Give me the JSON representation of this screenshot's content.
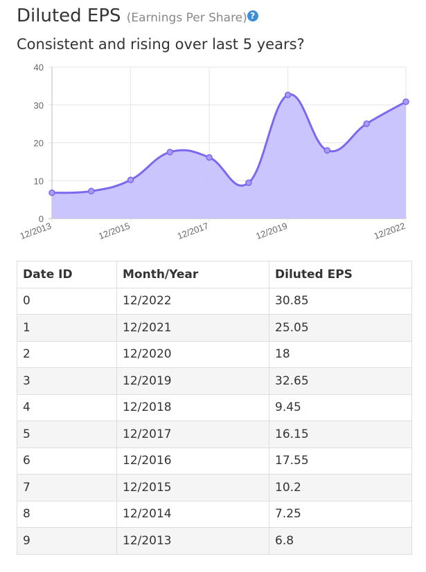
{
  "header": {
    "title": "Diluted EPS",
    "subtitle": "(Earnings Per Share)",
    "help_icon": "?",
    "question": "Consistent and rising over last 5 years?"
  },
  "chart_data": {
    "type": "area",
    "x": [
      "12/2013",
      "12/2014",
      "12/2015",
      "12/2016",
      "12/2017",
      "12/2018",
      "12/2019",
      "12/2020",
      "12/2021",
      "12/2022"
    ],
    "values": [
      6.8,
      7.25,
      10.2,
      17.55,
      16.15,
      9.45,
      32.65,
      18,
      25.05,
      30.85
    ],
    "x_tick_labels": [
      "12/2013",
      "12/2015",
      "12/2017",
      "12/2019",
      "12/2022"
    ],
    "y_ticks": [
      "0",
      "10",
      "20",
      "30",
      "40"
    ],
    "ylim": [
      0,
      40
    ],
    "grid": true,
    "line_color": "#7b68ee",
    "fill_color": "#c5bffd"
  },
  "table": {
    "headers": [
      "Date ID",
      "Month/Year",
      "Diluted EPS"
    ],
    "rows": [
      [
        "0",
        "12/2022",
        "30.85"
      ],
      [
        "1",
        "12/2021",
        "25.05"
      ],
      [
        "2",
        "12/2020",
        "18"
      ],
      [
        "3",
        "12/2019",
        "32.65"
      ],
      [
        "4",
        "12/2018",
        "9.45"
      ],
      [
        "5",
        "12/2017",
        "16.15"
      ],
      [
        "6",
        "12/2016",
        "17.55"
      ],
      [
        "7",
        "12/2015",
        "10.2"
      ],
      [
        "8",
        "12/2014",
        "7.25"
      ],
      [
        "9",
        "12/2013",
        "6.8"
      ]
    ]
  }
}
